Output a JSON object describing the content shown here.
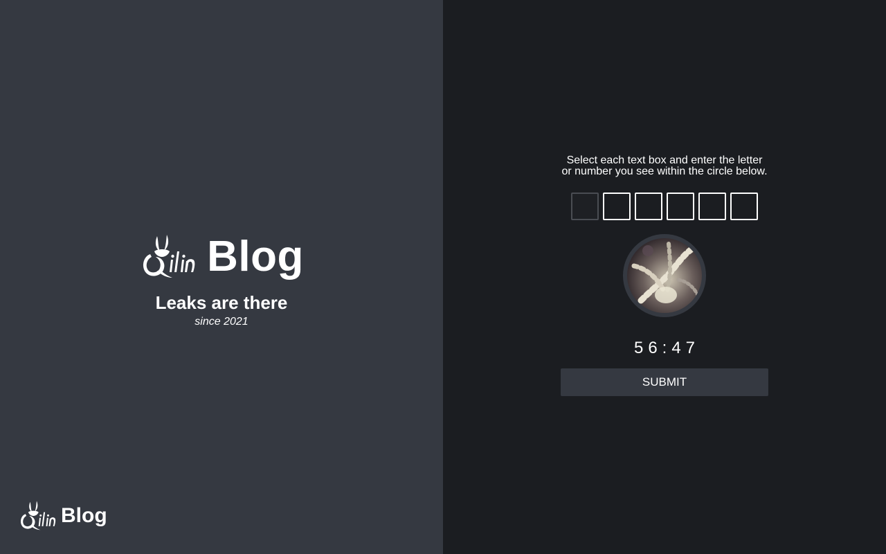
{
  "brand": {
    "title": "Blog",
    "tagline": "Leaks are there",
    "since": "since 2021"
  },
  "footer": {
    "title": "Blog"
  },
  "captcha": {
    "instructions": "Select each text box and enter the letter or number you see within the circle below.",
    "box_count": 6,
    "timer": "56:47",
    "submit_label": "SUBMIT"
  },
  "colors": {
    "left_panel": "#353941",
    "right_panel": "#1b1d21",
    "button": "#353941",
    "text": "#ffffff"
  },
  "icons": {
    "brand_logo": "qilin-logo-icon",
    "footer_logo": "qilin-logo-icon"
  }
}
